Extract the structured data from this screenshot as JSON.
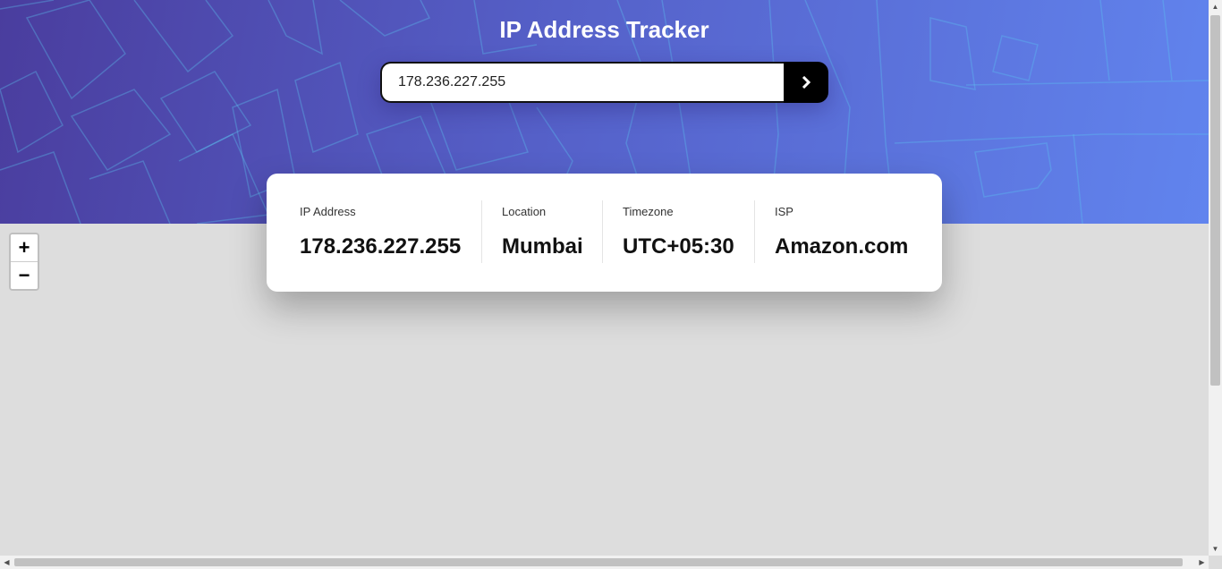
{
  "header": {
    "title": "IP Address Tracker"
  },
  "search": {
    "value": "178.236.227.255",
    "submit_icon": "chevron-right-icon"
  },
  "stats": [
    {
      "label": "IP Address",
      "value": "178.236.227.255"
    },
    {
      "label": "Location",
      "value": "Mumbai"
    },
    {
      "label": "Timezone",
      "value": "UTC+05:30"
    },
    {
      "label": "ISP",
      "value": "Amazon.com"
    }
  ],
  "map": {
    "zoom_in_label": "+",
    "zoom_out_label": "−"
  },
  "colors": {
    "hero_gradient_start": "#4a3d9e",
    "hero_gradient_end": "#6184ee",
    "button": "#000000",
    "map_background": "#dddddd"
  }
}
